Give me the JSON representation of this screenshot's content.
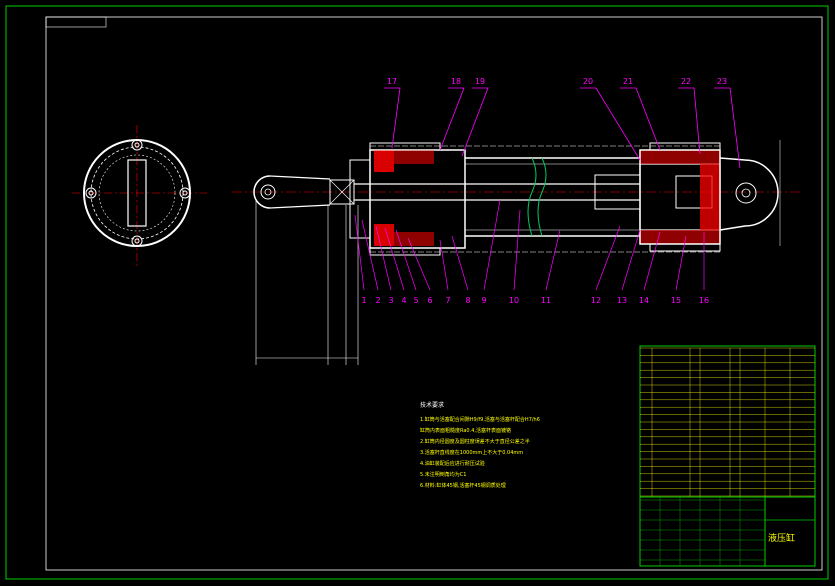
{
  "callouts_top": [
    "17",
    "18",
    "19",
    "20",
    "21",
    "22",
    "23"
  ],
  "callouts_bottom": [
    "1",
    "2",
    "3",
    "4",
    "5",
    "6",
    "7",
    "8",
    "9",
    "10",
    "11",
    "12",
    "13",
    "14",
    "15",
    "16"
  ],
  "notes": {
    "title": "技术要求",
    "lines": [
      "1.缸筒与活塞配合间隙H9/f9,活塞与活塞杆配合H7/h6",
      "缸筒内表面粗糙度Ra0.4,活塞杆表面镀铬",
      "2.缸筒内径圆度及圆柱度误差不大于直径公差之半",
      "3.活塞杆直线度在1000mm上不大于0.04mm",
      "4.油缸装配后应进行耐压试验",
      "5.未注明倒角均为C1",
      "6.材料:缸体45钢,活塞杆45钢调质处理"
    ]
  },
  "title_block": {
    "title": "液压缸"
  },
  "colors": {
    "frame": "#00cc00",
    "callout": "#ff00ff",
    "part": "#ffffff",
    "hatch": "#ff0000",
    "table": "#ffff00",
    "center": "#ff0000"
  }
}
